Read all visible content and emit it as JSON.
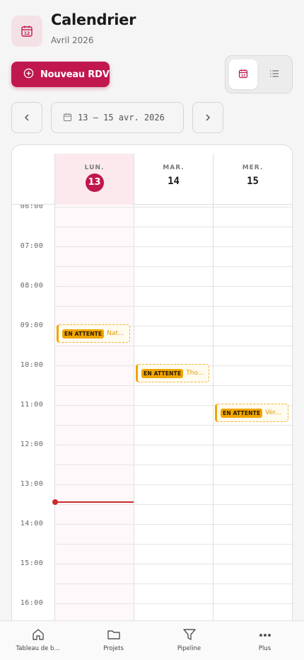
{
  "header": {
    "title": "Calendrier",
    "subtitle": "Avril 2026",
    "icon": "calendar-icon"
  },
  "toolbar": {
    "new_label": "Nouveau RDV",
    "new_icon": "plus-circle-icon",
    "view_calendar_icon": "calendar-icon",
    "view_list_icon": "list-icon",
    "active_view": "calendar"
  },
  "date_nav": {
    "prev_icon": "chevron-left-icon",
    "next_icon": "chevron-right-icon",
    "range_label": "13 – 15 avr. 2026"
  },
  "days": [
    {
      "dow": "LUN.",
      "num": "13",
      "today": true
    },
    {
      "dow": "MAR.",
      "num": "14",
      "today": false
    },
    {
      "dow": "MER.",
      "num": "15",
      "today": false
    }
  ],
  "hours": [
    "06:00",
    "07:00",
    "08:00",
    "09:00",
    "10:00",
    "11:00",
    "12:00",
    "13:00",
    "14:00",
    "15:00",
    "16:00"
  ],
  "events": [
    {
      "day": 0,
      "badge": "EN ATTENTE",
      "name": "Nat..."
    },
    {
      "day": 1,
      "badge": "EN ATTENTE",
      "name": "Tho..."
    },
    {
      "day": 2,
      "badge": "EN ATTENTE",
      "name": "Vér..."
    }
  ],
  "bottom_nav": [
    {
      "label": "Tableau de b...",
      "icon": "home-icon"
    },
    {
      "label": "Projets",
      "icon": "folder-icon"
    },
    {
      "label": "Pipeline",
      "icon": "filter-icon"
    },
    {
      "label": "Plus",
      "icon": "more-icon"
    }
  ],
  "colors": {
    "accent": "#c0174f",
    "pending": "#f0a500",
    "now": "#c92a2a"
  }
}
